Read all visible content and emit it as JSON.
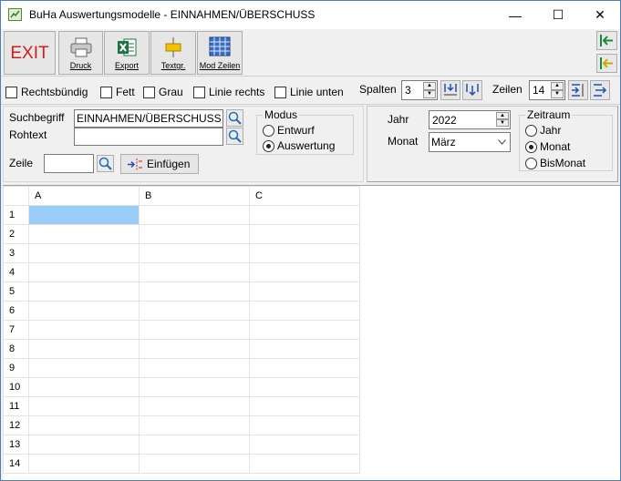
{
  "window": {
    "title": "BuHa Auswertungsmodelle - EINNAHMEN/ÜBERSCHUSS",
    "minimize_glyph": "—",
    "maximize_glyph": "☐",
    "close_glyph": "✕"
  },
  "toolbar": {
    "exit_label": "EXIT",
    "druck_label": "Druck",
    "export_label": "Export",
    "textgr_label": "Textgr.",
    "modzeilen_label": "Mod Zeilen"
  },
  "format": {
    "rechtsbuendig": "Rechtsbündig",
    "fett": "Fett",
    "grau": "Grau",
    "linie_rechts": "Linie rechts",
    "linie_unten": "Linie unten",
    "spalten_label": "Spalten",
    "spalten_value": "3",
    "zeilen_label": "Zeilen",
    "zeilen_value": "14"
  },
  "search": {
    "suchbegriff_label": "Suchbegriff",
    "suchbegriff_value": "EINNAHMEN/ÜBERSCHUSS",
    "rohtext_label": "Rohtext",
    "rohtext_value": "",
    "zeile_label": "Zeile",
    "zeile_value": "",
    "einfuegen_label": "Einfügen"
  },
  "modus": {
    "legend": "Modus",
    "options": [
      "Entwurf",
      "Auswertung"
    ],
    "selected": "Auswertung"
  },
  "period": {
    "jahr_label": "Jahr",
    "jahr_value": "2022",
    "monat_label": "Monat",
    "monat_value": "März"
  },
  "zeitraum": {
    "legend": "Zeitraum",
    "options": [
      "Jahr",
      "Monat",
      "BisMonat"
    ],
    "selected": "Monat"
  },
  "grid": {
    "columns": [
      "A",
      "B",
      "C"
    ],
    "rows": [
      "1",
      "2",
      "3",
      "4",
      "5",
      "6",
      "7",
      "8",
      "9",
      "10",
      "11",
      "12",
      "13",
      "14"
    ]
  },
  "colors": {
    "exit_red": "#d41c1c",
    "selection_blue": "#99ccf7"
  }
}
